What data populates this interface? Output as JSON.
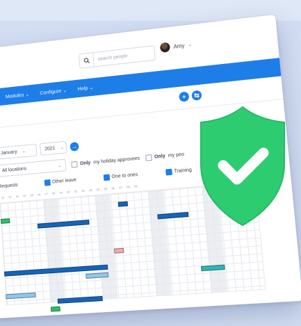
{
  "header": {
    "search_placeholder": "search people",
    "user_name": "Amy",
    "user_chevron": "⌄"
  },
  "nav": {
    "items": [
      "Modules ⌄",
      "Configure ⌄",
      "Help ⌄"
    ]
  },
  "toolbar": {
    "add_icon": "+",
    "export_icon": "⇆"
  },
  "filters": {
    "month": "January",
    "year": "2021",
    "location": "All locations",
    "go_icon": "→",
    "only_holiday_bold": "Only",
    "only_holiday_rest": "my holiday approvees",
    "only_people_bold": "Only",
    "only_people_rest": "my peo"
  },
  "legend": {
    "requests": "Requests",
    "other_leave": "Other leave",
    "one_to_ones": "One to ones",
    "training": "Training"
  },
  "calendar": {
    "days": [
      "11",
      "12",
      "13",
      "14",
      "15",
      "16",
      "17",
      "18",
      "19",
      "20",
      "21",
      "22",
      "23",
      "24",
      "25",
      "26",
      "27",
      "28",
      "29"
    ]
  },
  "colors": {
    "accent": "#1e7ee8",
    "shield": "#2ecc71",
    "bar_dark": "#1565b8",
    "bar_light": "#8fc7ea",
    "bar_teal": "#30b6b4",
    "bar_green": "#2fbf6a",
    "bar_pink": "#f3a9ad"
  },
  "icons": {
    "search": "search-icon",
    "shield": "shield-check-icon"
  }
}
